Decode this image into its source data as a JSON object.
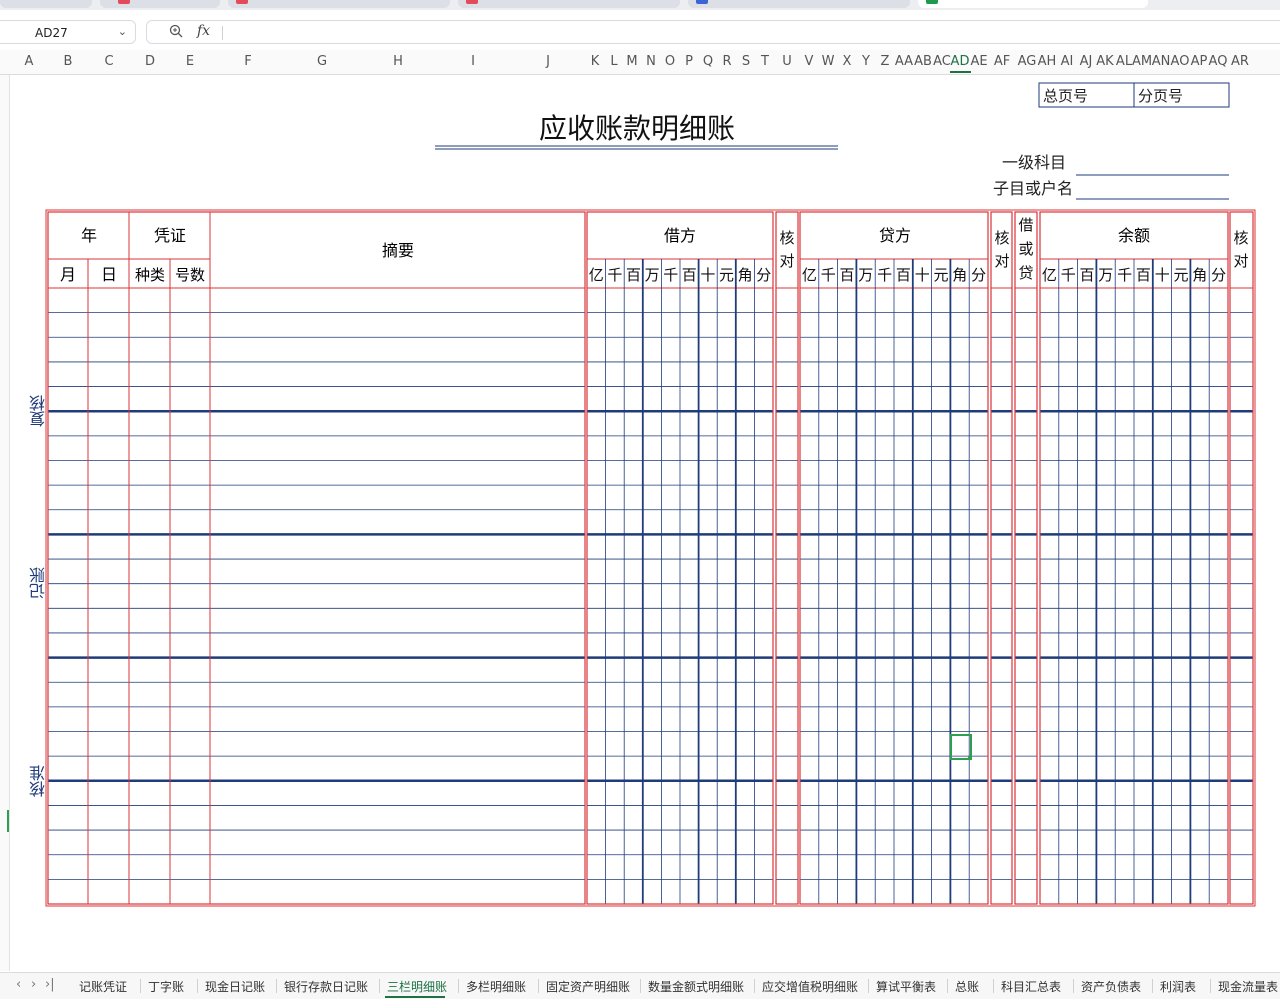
{
  "formula_bar": {
    "cell_ref": "AD27",
    "zoom_icon": "magnifier-icon",
    "fx_label": "fx",
    "formula_value": ""
  },
  "columns": [
    "A",
    "B",
    "C",
    "D",
    "E",
    "F",
    "G",
    "H",
    "I",
    "J",
    "K",
    "L",
    "M",
    "N",
    "O",
    "P",
    "Q",
    "R",
    "S",
    "T",
    "U",
    "V",
    "W",
    "X",
    "Y",
    "Z",
    "AA",
    "AB",
    "AC",
    "AD",
    "AE",
    "AF",
    "AG",
    "AH",
    "AI",
    "AJ",
    "AK",
    "AL",
    "AM",
    "AN",
    "AO",
    "AP",
    "AQ",
    "AR"
  ],
  "active_column": "AD",
  "ledger": {
    "title": "应收账款明细账",
    "total_page_label": "总页号",
    "sub_page_label": "分页号",
    "account_level1_label": "一级科目",
    "sub_account_label": "子目或户名",
    "headers": {
      "year": "年",
      "month": "月",
      "day": "日",
      "voucher": "凭证",
      "voucher_type": "种类",
      "voucher_no": "号数",
      "summary": "摘要",
      "debit": "借方",
      "credit": "贷方",
      "balance": "余额",
      "check": "核对",
      "debit_or_credit": "借或贷"
    },
    "digit_units": [
      "亿",
      "千",
      "百",
      "万",
      "千",
      "百",
      "十",
      "元",
      "角",
      "分"
    ],
    "side_labels": [
      "复核",
      "记账",
      "核准"
    ],
    "body_rows": 25
  },
  "sheet_tabs": [
    "记账凭证",
    "丁字账",
    "现金日记账",
    "银行存款日记账",
    "三栏明细账",
    "多栏明细账",
    "固定资产明细账",
    "数量金额式明细账",
    "应交增值税明细账",
    "算试平衡表",
    "总账",
    "科目汇总表",
    "资产负债表",
    "利润表",
    "现金流量表"
  ],
  "active_sheet": "三栏明细账",
  "nav_icons": [
    "prev-sheet-icon",
    "next-sheet-icon",
    "last-sheet-icon"
  ],
  "nav_glyphs": [
    "‹",
    "›",
    "›|"
  ],
  "colors": {
    "red_border": "#d9343a",
    "blue_line": "#1f3b7a",
    "accent_green": "#1e7145"
  }
}
